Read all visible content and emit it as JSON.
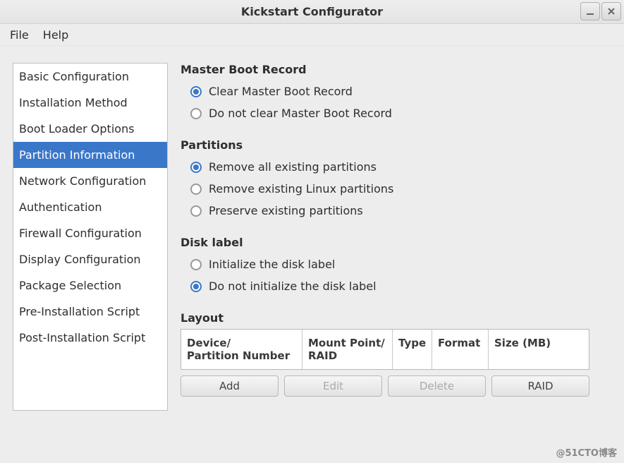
{
  "window": {
    "title": "Kickstart Configurator"
  },
  "menubar": {
    "file": "File",
    "help": "Help"
  },
  "sidebar": {
    "items": [
      "Basic Configuration",
      "Installation Method",
      "Boot Loader Options",
      "Partition Information",
      "Network Configuration",
      "Authentication",
      "Firewall Configuration",
      "Display Configuration",
      "Package Selection",
      "Pre-Installation Script",
      "Post-Installation Script"
    ]
  },
  "mbr": {
    "header": "Master Boot Record",
    "opt1": "Clear Master Boot Record",
    "opt2": "Do not clear Master Boot Record"
  },
  "partitions": {
    "header": "Partitions",
    "opt1": "Remove all existing partitions",
    "opt2": "Remove existing Linux partitions",
    "opt3": "Preserve existing partitions"
  },
  "disklabel": {
    "header": "Disk label",
    "opt1": "Initialize the disk label",
    "opt2": "Do not initialize the disk label"
  },
  "layout": {
    "header": "Layout",
    "cols": {
      "c1": "Device/\nPartition Number",
      "c2": "Mount Point/\nRAID",
      "c3": "Type",
      "c4": "Format",
      "c5": "Size (MB)"
    },
    "buttons": {
      "add": "Add",
      "edit": "Edit",
      "delete": "Delete",
      "raid": "RAID"
    }
  },
  "watermark": "@51CTO博客"
}
